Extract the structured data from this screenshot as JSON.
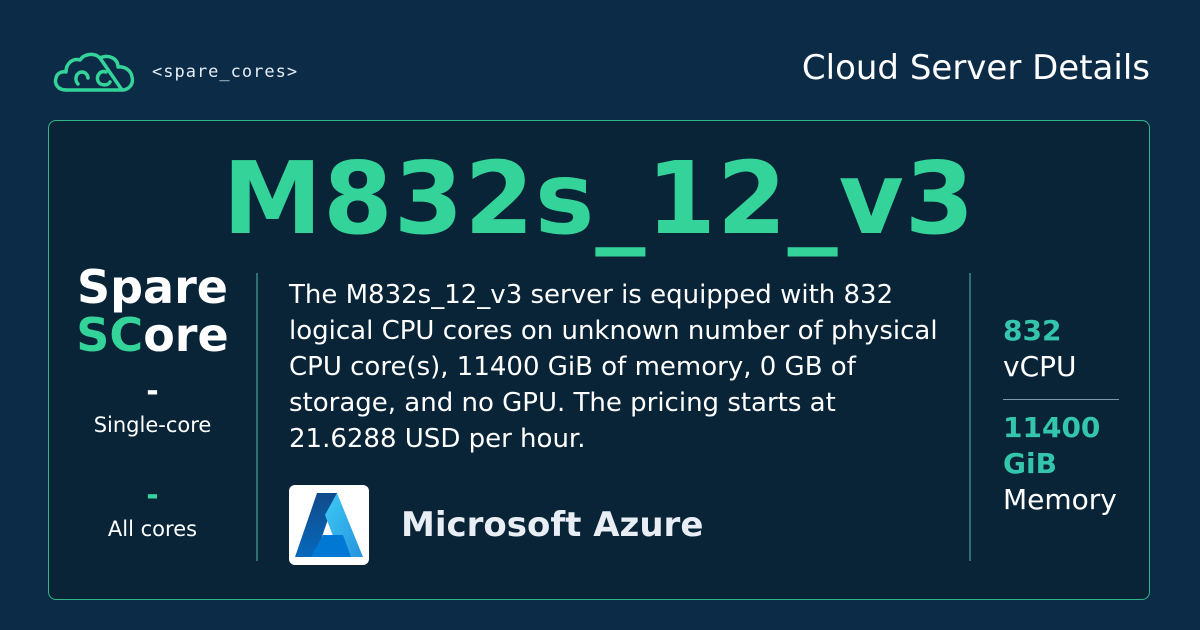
{
  "header": {
    "brand": "<spare_cores>",
    "title": "Cloud Server Details"
  },
  "server": {
    "name": "M832s_12_v3",
    "description": "The M832s_12_v3 server is equipped with 832 logical CPU cores on unknown number of physical CPU core(s), 11400 GiB of memory, 0 GB of storage, and no GPU. The pricing starts at 21.6288 USD per hour."
  },
  "score": {
    "title_line1": "Spare",
    "title_sc": "SC",
    "title_ore": "ore",
    "single_core_value": "-",
    "single_core_label": "Single-core",
    "all_cores_value": "-",
    "all_cores_label": "All cores"
  },
  "provider": {
    "name": "Microsoft Azure",
    "icon": "azure-logo"
  },
  "specs": {
    "vcpu_value": "832",
    "vcpu_label": "vCPU",
    "memory_value": "11400 GiB",
    "memory_label": "Memory"
  },
  "colors": {
    "background": "#0b2b47",
    "accent": "#34d399",
    "spec_accent": "#34c5ad"
  }
}
